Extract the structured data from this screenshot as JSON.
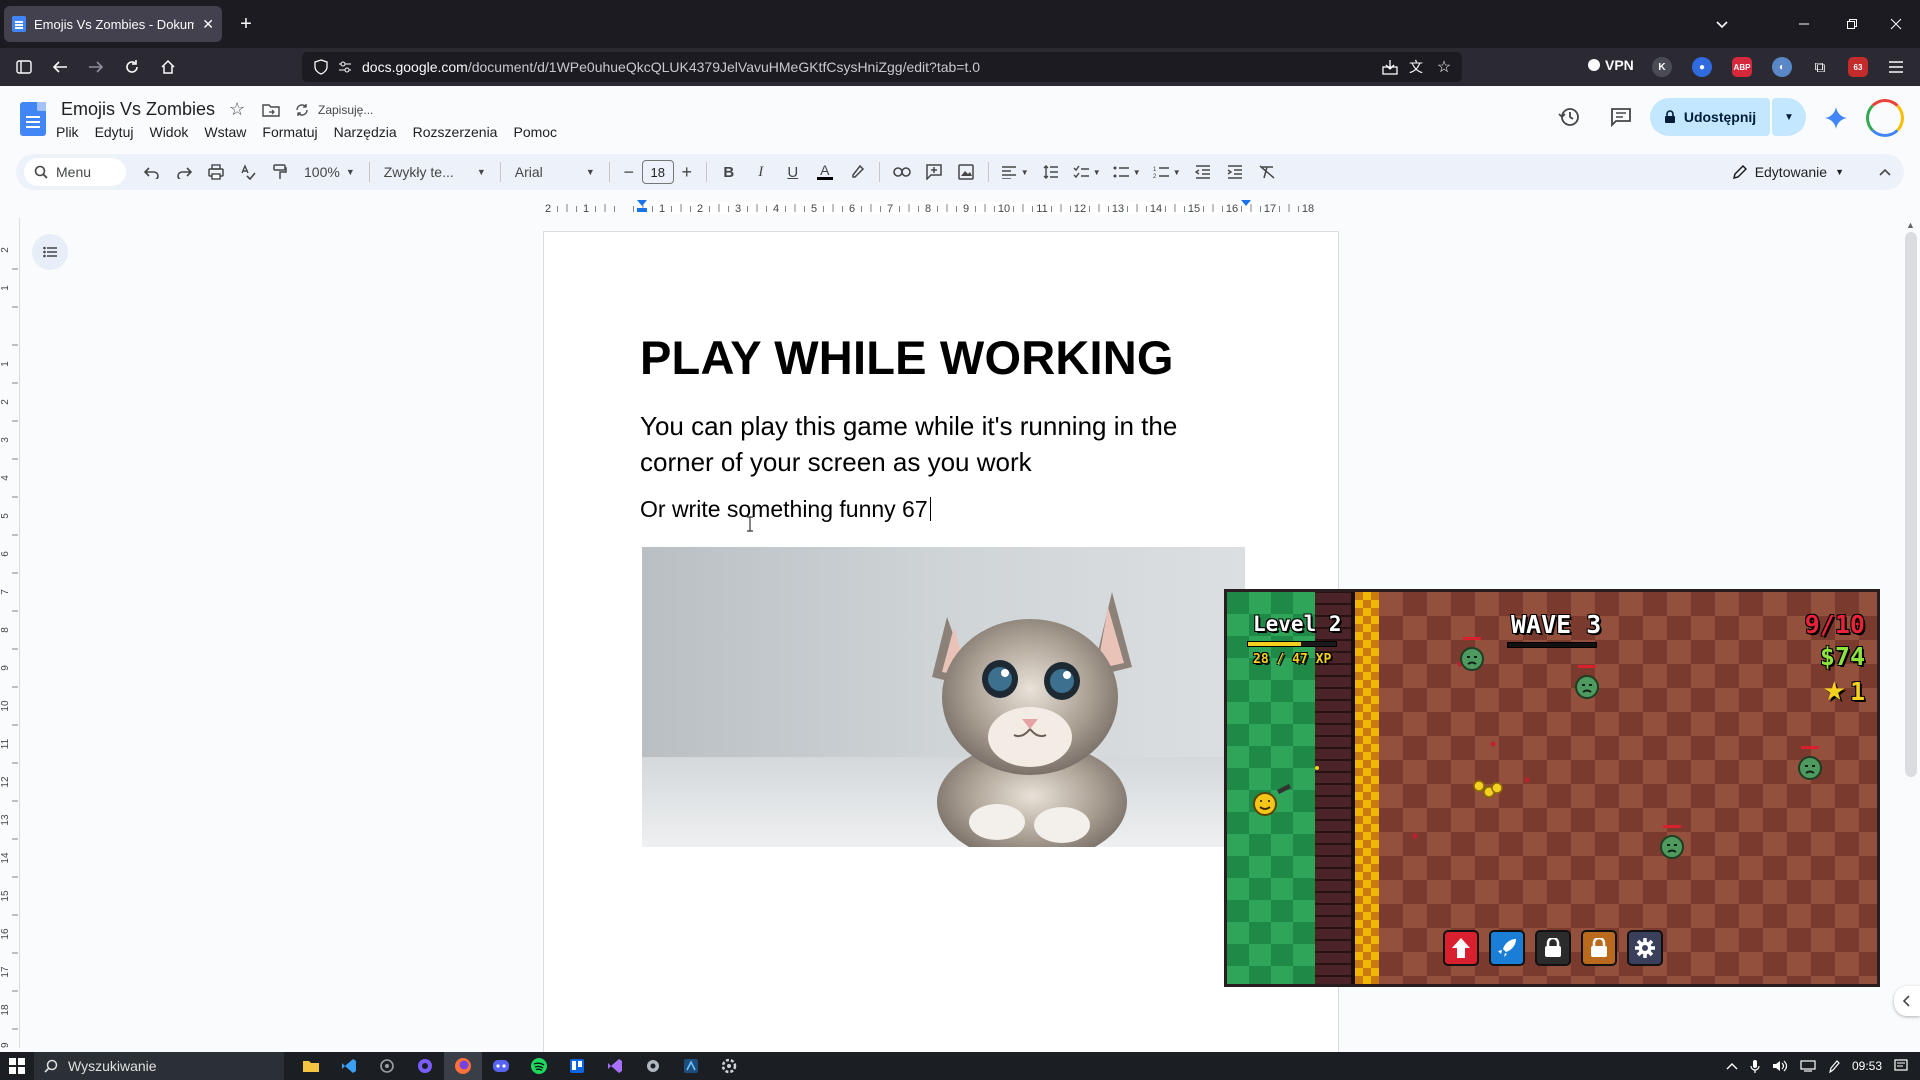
{
  "browser": {
    "tab_title": "Emojis Vs Zombies - Dokument",
    "url_domain": "docs.google.com",
    "url_path": "/document/d/1WPe0uhueQkcQLUK4379JelVavuHMeGKtfCsysHniZgg/edit?tab=t.0",
    "vpn_label": "VPN",
    "ext_badge": "63"
  },
  "docs": {
    "title": "Emojis Vs Zombies",
    "status": "Zapisuję...",
    "menu": [
      "Plik",
      "Edytuj",
      "Widok",
      "Wstaw",
      "Formatuj",
      "Narzędzia",
      "Rozszerzenia",
      "Pomoc"
    ],
    "share_label": "Udostępnij"
  },
  "toolbar": {
    "search_label": "Menu",
    "zoom": "100%",
    "style": "Zwykły te...",
    "font": "Arial",
    "font_size": "18",
    "mode": "Edytowanie"
  },
  "ruler": {
    "ticks": [
      "2",
      "1",
      "",
      "1",
      "2",
      "3",
      "4",
      "5",
      "6",
      "7",
      "8",
      "9",
      "10",
      "11",
      "12",
      "13",
      "14",
      "15",
      "16",
      "17",
      "18"
    ],
    "vticks": [
      "2",
      "1",
      "",
      "1",
      "2",
      "3",
      "4",
      "5",
      "6",
      "7",
      "8",
      "9",
      "10",
      "11",
      "12",
      "13",
      "14",
      "15",
      "16",
      "17",
      "18",
      "19"
    ]
  },
  "document": {
    "heading": "PLAY WHILE WORKING",
    "paragraph1": "You can play this game while it's running in the corner of your screen as you work",
    "paragraph2": "Or write something funny 67"
  },
  "game": {
    "level": "Level 2",
    "xp": "28 / 47 XP",
    "xp_progress": 0.6,
    "wave": "WAVE 3",
    "wave_count": "9/10",
    "money": "$74",
    "stars": "1",
    "colors": {
      "red": "#e8233a",
      "green": "#8fe341",
      "yellow": "#f5d020"
    },
    "buttons": [
      "upgrade-arrow-icon",
      "rocket-icon",
      "lock-icon",
      "lock-icon",
      "settings-gear-icon"
    ]
  },
  "taskbar": {
    "search_placeholder": "Wyszukiwanie",
    "time": "09:53"
  }
}
